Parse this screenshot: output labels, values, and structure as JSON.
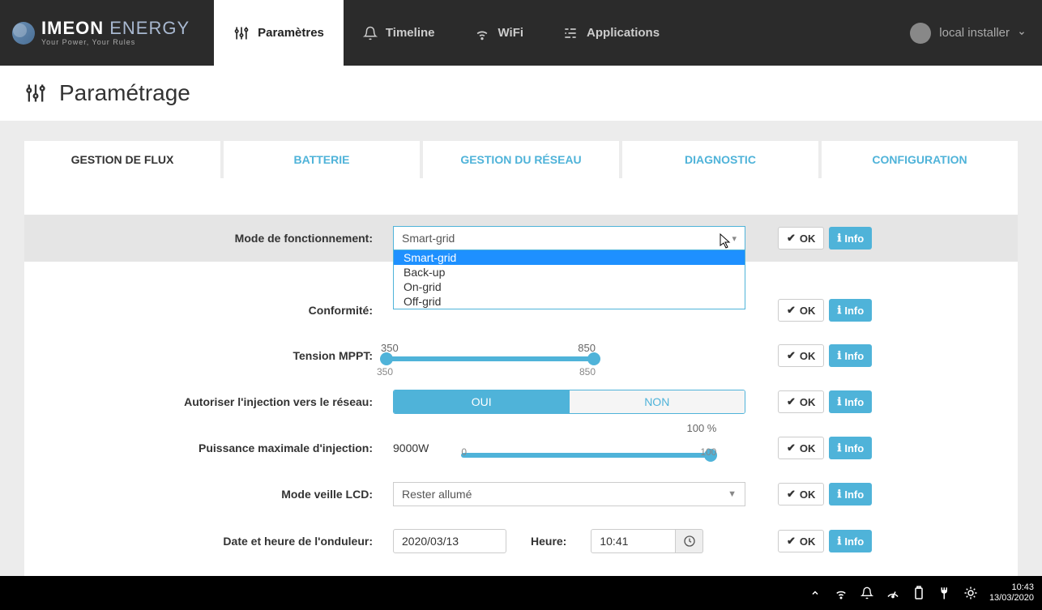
{
  "brand": {
    "main1": "IMEON",
    "main2": "ENERGY",
    "sub": "Your Power, Your Rules"
  },
  "nav": {
    "params": "Paramètres",
    "timeline": "Timeline",
    "wifi": "WiFi",
    "apps": "Applications"
  },
  "user": {
    "name": "local installer"
  },
  "page": {
    "title": "Paramétrage"
  },
  "tabs": {
    "flux": "GESTION DE FLUX",
    "batterie": "BATTERIE",
    "reseau": "GESTION DU RÉSEAU",
    "diag": "DIAGNOSTIC",
    "config": "CONFIGURATION"
  },
  "labels": {
    "mode": "Mode de fonctionnement:",
    "conformite": "Conformité:",
    "mppt": "Tension MPPT:",
    "injection": "Autoriser l'injection vers le réseau:",
    "pmax": "Puissance maximale d'injection:",
    "lcd": "Mode veille LCD:",
    "datetime": "Date et heure de l'onduleur:",
    "heure": "Heure:"
  },
  "mode": {
    "selected": "Smart-grid",
    "options": {
      "o0": "Smart-grid",
      "o1": "Back-up",
      "o2": "On-grid",
      "o3": "Off-grid"
    }
  },
  "mppt": {
    "lowLabelTop": "350",
    "highLabelTop": "850",
    "lowLabelBottom": "350",
    "highLabelBottom": "850"
  },
  "injection": {
    "oui": "OUI",
    "non": "NON"
  },
  "pmax": {
    "value": "9000W",
    "percent": "100 %",
    "min": "0",
    "max": "100"
  },
  "lcd": {
    "selected": "Rester allumé"
  },
  "datetime": {
    "date": "2020/03/13",
    "time": "10:41"
  },
  "buttons": {
    "ok": "OK",
    "info": "Info"
  },
  "tray": {
    "time": "10:43",
    "date": "13/03/2020"
  }
}
